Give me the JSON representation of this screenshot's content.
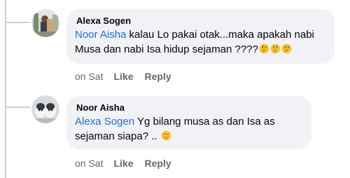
{
  "comments": [
    {
      "author": "Alexa Sogen",
      "mention": "Noor Aisha",
      "text": " kalau Lo pakai otak...maka apakah nabi Musa dan nabi Isa hidup sejaman ????",
      "emojis": [
        "thinking-face-emoji",
        "thinking-face-emoji",
        "thinking-face-emoji"
      ],
      "time": "on Sat",
      "like_label": "Like",
      "reply_label": "Reply"
    },
    {
      "author": "Noor Aisha",
      "mention": "Alexa Sogen",
      "text": " Yg bilang musa as dan Isa as sejaman siapa? .. ",
      "emojis": [
        "face-with-hand-over-mouth-emoji"
      ],
      "time": "on Sat",
      "like_label": "Like",
      "reply_label": "Reply"
    }
  ],
  "colors": {
    "bubble_bg": "#f0f2f5",
    "mention": "#216fdb",
    "meta_text": "#65676b",
    "thread_line": "#ced0d4"
  }
}
